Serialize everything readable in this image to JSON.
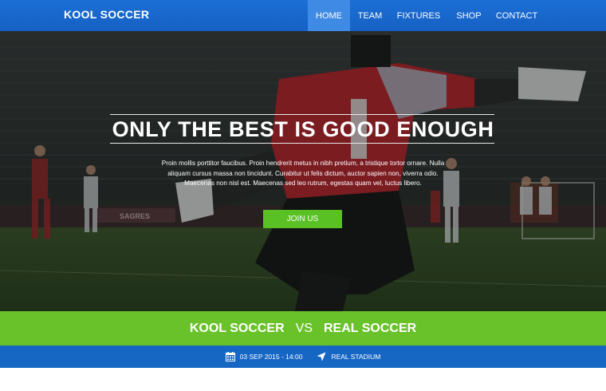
{
  "navbar": {
    "brand": "KOOL SOCCER",
    "items": [
      {
        "label": "HOME",
        "active": true
      },
      {
        "label": "TEAM",
        "active": false
      },
      {
        "label": "FIXTURES",
        "active": false
      },
      {
        "label": "SHOP",
        "active": false
      },
      {
        "label": "CONTACT",
        "active": false
      }
    ]
  },
  "hero": {
    "title": "ONLY THE BEST IS GOOD ENOUGH",
    "text_lines": [
      "Proin mollis porttitor faucibus. Proin hendrerit metus in nibh pretium, a tristique tortor ornare. Nulla",
      "aliquam cursus massa non tincidunt. Curabitur ut felis dictum, auctor sapien non, viverra odio.",
      "Maecenas non nisl est. Maecenas sed leo rutrum, egestas quam vel, luctus libero."
    ],
    "cta_label": "JOIN US",
    "banner_text": "SAGRES"
  },
  "match": {
    "home_team": "KOOL SOCCER",
    "vs": "VS",
    "away_team": "REAL SOCCER"
  },
  "info": {
    "date": "03 SEP 2015 - 14:00",
    "venue": "REAL STADIUM",
    "date_icon": "calendar-icon",
    "venue_icon": "location-arrow-icon"
  },
  "colors": {
    "nav_blue": "#1b6fd6",
    "nav_active": "#3f8ae4",
    "accent_green": "#5ac125",
    "match_green": "#6ac22b",
    "info_blue": "#1666c4"
  }
}
